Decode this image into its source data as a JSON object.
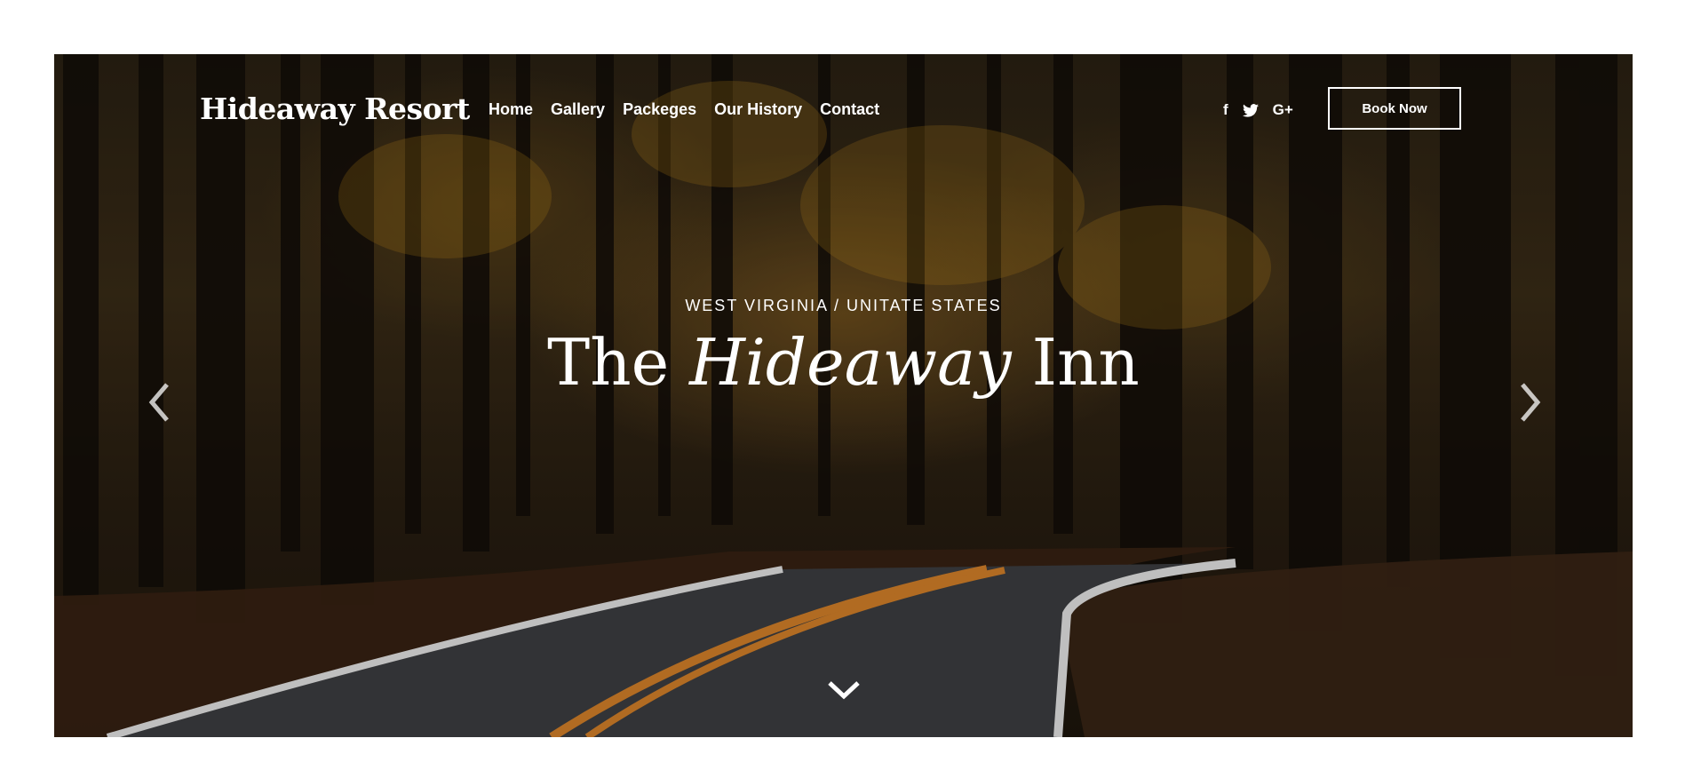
{
  "header": {
    "logo": "Hideaway Resort",
    "nav": [
      "Home",
      "Gallery",
      "Packeges",
      "Our History",
      "Contact"
    ],
    "social": [
      {
        "icon": "facebook-icon",
        "glyph": "f"
      },
      {
        "icon": "twitter-icon",
        "glyph": "🐦"
      },
      {
        "icon": "google-plus-icon",
        "glyph": "G+"
      }
    ],
    "book_label": "Book Now"
  },
  "hero": {
    "kicker": "WEST VIRGINIA / UNITATE STATES",
    "title_pre": "The ",
    "title_em": "Hideaway",
    "title_post": " Inn"
  },
  "icons": {
    "prev": "chevron-left-icon",
    "next": "chevron-right-icon",
    "scroll": "chevron-down-icon"
  },
  "colors": {
    "text": "#ffffff",
    "road": "#3d3f42",
    "road_line": "#d8832a"
  }
}
